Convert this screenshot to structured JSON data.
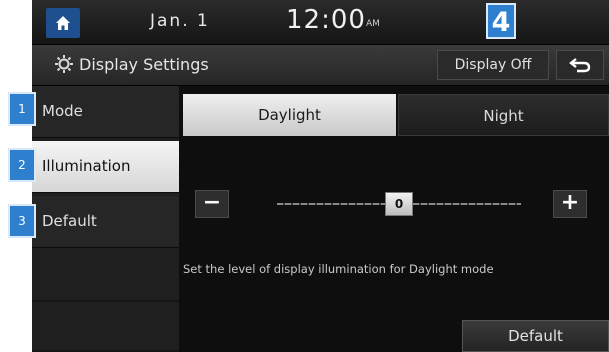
{
  "status": {
    "date": "Jan. 1",
    "time": "12:00",
    "ampm": "AM",
    "callout": "4"
  },
  "titlebar": {
    "title": "Display Settings",
    "display_off_label": "Display Off"
  },
  "sidebar": {
    "items": [
      {
        "label": "Mode",
        "marker": "1",
        "active": false
      },
      {
        "label": "Illumination",
        "marker": "2",
        "active": true
      },
      {
        "label": "Default",
        "marker": "3",
        "active": false
      }
    ]
  },
  "main": {
    "tabs": [
      {
        "label": "Daylight",
        "selected": true
      },
      {
        "label": "Night",
        "selected": false
      }
    ],
    "slider": {
      "value": "0",
      "min": -10,
      "max": 10
    },
    "description": "Set the level of display illumination for Daylight mode",
    "default_button_label": "Default"
  },
  "colors": {
    "marker": "#2f7fcf",
    "home_button": "#1e4f8e"
  }
}
